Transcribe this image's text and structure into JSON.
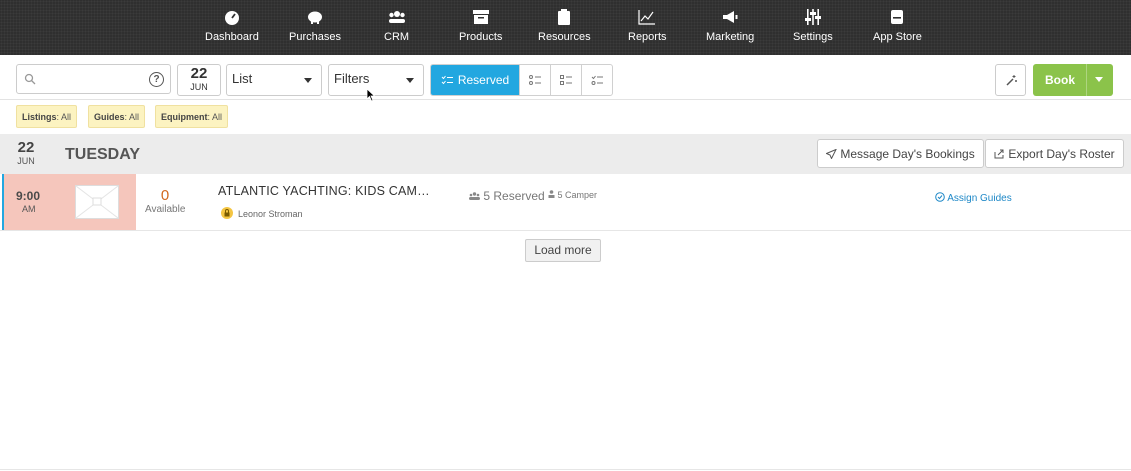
{
  "nav": {
    "items": [
      {
        "label": "Dashboard",
        "icon": "gauge-icon"
      },
      {
        "label": "Purchases",
        "icon": "piggy-bank-icon"
      },
      {
        "label": "CRM",
        "icon": "users-icon"
      },
      {
        "label": "Products",
        "icon": "archive-box-icon"
      },
      {
        "label": "Resources",
        "icon": "clipboard-icon"
      },
      {
        "label": "Reports",
        "icon": "line-chart-icon"
      },
      {
        "label": "Marketing",
        "icon": "megaphone-icon"
      },
      {
        "label": "Settings",
        "icon": "sliders-icon"
      },
      {
        "label": "App Store",
        "icon": "store-icon"
      }
    ]
  },
  "toolbar": {
    "search_value": "",
    "help_label": "?",
    "date": {
      "day": "22",
      "month": "JUN"
    },
    "view_select": "List",
    "filters_select": "Filters",
    "reserved_label": "Reserved",
    "book_label": "Book"
  },
  "filters": {
    "chips": [
      {
        "key": "Listings",
        "value": ": All"
      },
      {
        "key": "Guides",
        "value": ": All"
      },
      {
        "key": "Equipment",
        "value": ": All"
      }
    ]
  },
  "day": {
    "day": "22",
    "month": "JUN",
    "weekday": "TUESDAY",
    "message_label": "Message Day's Bookings",
    "export_label": "Export Day's Roster"
  },
  "booking": {
    "time": "9:00",
    "ampm": "AM",
    "available_count": "0",
    "available_label": "Available",
    "title": "ATLANTIC YACHTING: KIDS CAM…",
    "guide": "Leonor Stroman",
    "reserved": "5 Reserved",
    "camper": "5 Camper",
    "assign_label": "Assign Guides"
  },
  "load_more_label": "Load more",
  "colors": {
    "accent_blue": "#22a7e0",
    "book_green": "#8bc34a",
    "chip_yellow": "#fcf3c1",
    "time_cell": "#f5c6bc",
    "available_orange": "#d2691e"
  }
}
